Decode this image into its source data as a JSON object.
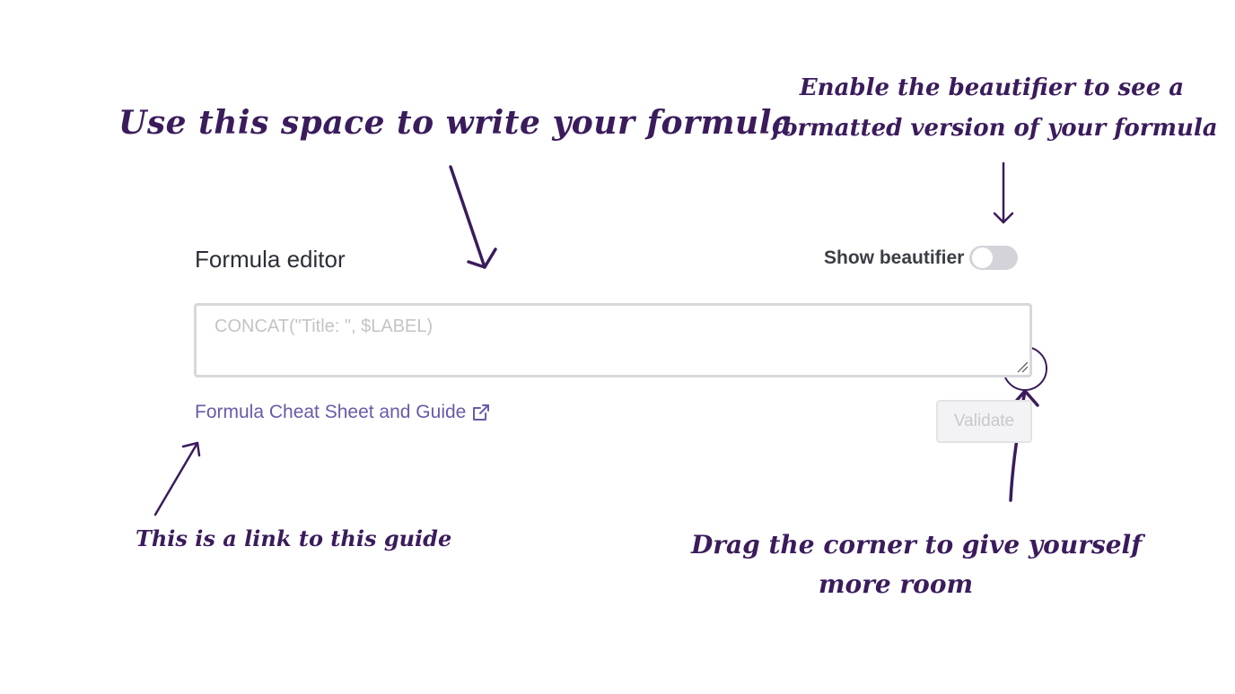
{
  "annotations": {
    "write_formula": "Use this space to write your formula",
    "beautifier_line1": "Enable the beautifier to see a",
    "beautifier_line2": "formatted version of your formula",
    "link_note": "This is a link to this guide",
    "drag_line1": "Drag the corner to give yourself",
    "drag_line2": "more room",
    "color": "#3a1c5c"
  },
  "editor": {
    "label": "Formula editor",
    "beautifier_label": "Show beautifier",
    "beautifier_enabled": false,
    "input_value": "",
    "input_placeholder": "CONCAT(\"Title: \", $LABEL)",
    "guide_link_label": "Formula Cheat Sheet and Guide",
    "guide_link_icon": "external-link-icon",
    "validate_label": "Validate",
    "validate_disabled": true,
    "link_color": "#6a5aa8"
  }
}
